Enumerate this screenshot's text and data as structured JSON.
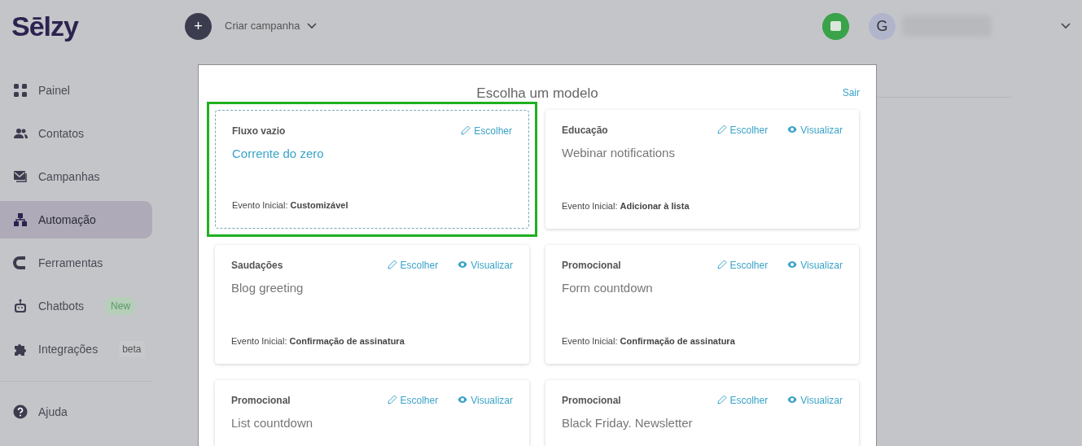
{
  "header": {
    "logo": "Sēlzy",
    "create_button": "+",
    "create_label": "Criar campanha",
    "avatar_letter": "G"
  },
  "sidebar": {
    "items": [
      {
        "label": "Painel",
        "selected": false
      },
      {
        "label": "Contatos",
        "selected": false
      },
      {
        "label": "Campanhas",
        "selected": false
      },
      {
        "label": "Automação",
        "selected": true
      },
      {
        "label": "Ferramentas",
        "selected": false
      },
      {
        "label": "Chatbots",
        "selected": false,
        "badge": "New",
        "kind": "new"
      },
      {
        "label": "Integrações",
        "selected": false,
        "badge": "beta",
        "kind": "beta"
      }
    ],
    "footer_item": {
      "label": "Ajuda"
    }
  },
  "modal": {
    "title": "Escolha um modelo",
    "close_link": "Sair",
    "templates": [
      {
        "kind": "blank",
        "highlighted": true,
        "category": "Fluxo vazio",
        "name": "Corrente do zero",
        "choose": "Escolher",
        "event_label": "Evento Inicial:",
        "event_value": "Customizável"
      },
      {
        "kind": "template",
        "highlighted": false,
        "category": "Educação",
        "name": "Webinar notifications",
        "choose": "Escolher",
        "preview": "Visualizar",
        "event_label": "Evento Inicial:",
        "event_value": "Adicionar à lista"
      },
      {
        "kind": "template",
        "highlighted": false,
        "category": "Saudações",
        "name": "Blog greeting",
        "choose": "Escolher",
        "preview": "Visualizar",
        "event_label": "Evento Inicial:",
        "event_value": "Confirmação de assinatura"
      },
      {
        "kind": "template",
        "highlighted": false,
        "category": "Promocional",
        "name": "Form countdown",
        "choose": "Escolher",
        "preview": "Visualizar",
        "event_label": "Evento Inicial:",
        "event_value": "Confirmação de assinatura"
      },
      {
        "kind": "template",
        "highlighted": false,
        "category": "Promocional",
        "name": "List countdown",
        "choose": "Escolher",
        "preview": "Visualizar"
      },
      {
        "kind": "template",
        "highlighted": false,
        "category": "Promocional",
        "name": "Black Friday. Newsletter",
        "choose": "Escolher",
        "preview": "Visualizar"
      }
    ]
  }
}
